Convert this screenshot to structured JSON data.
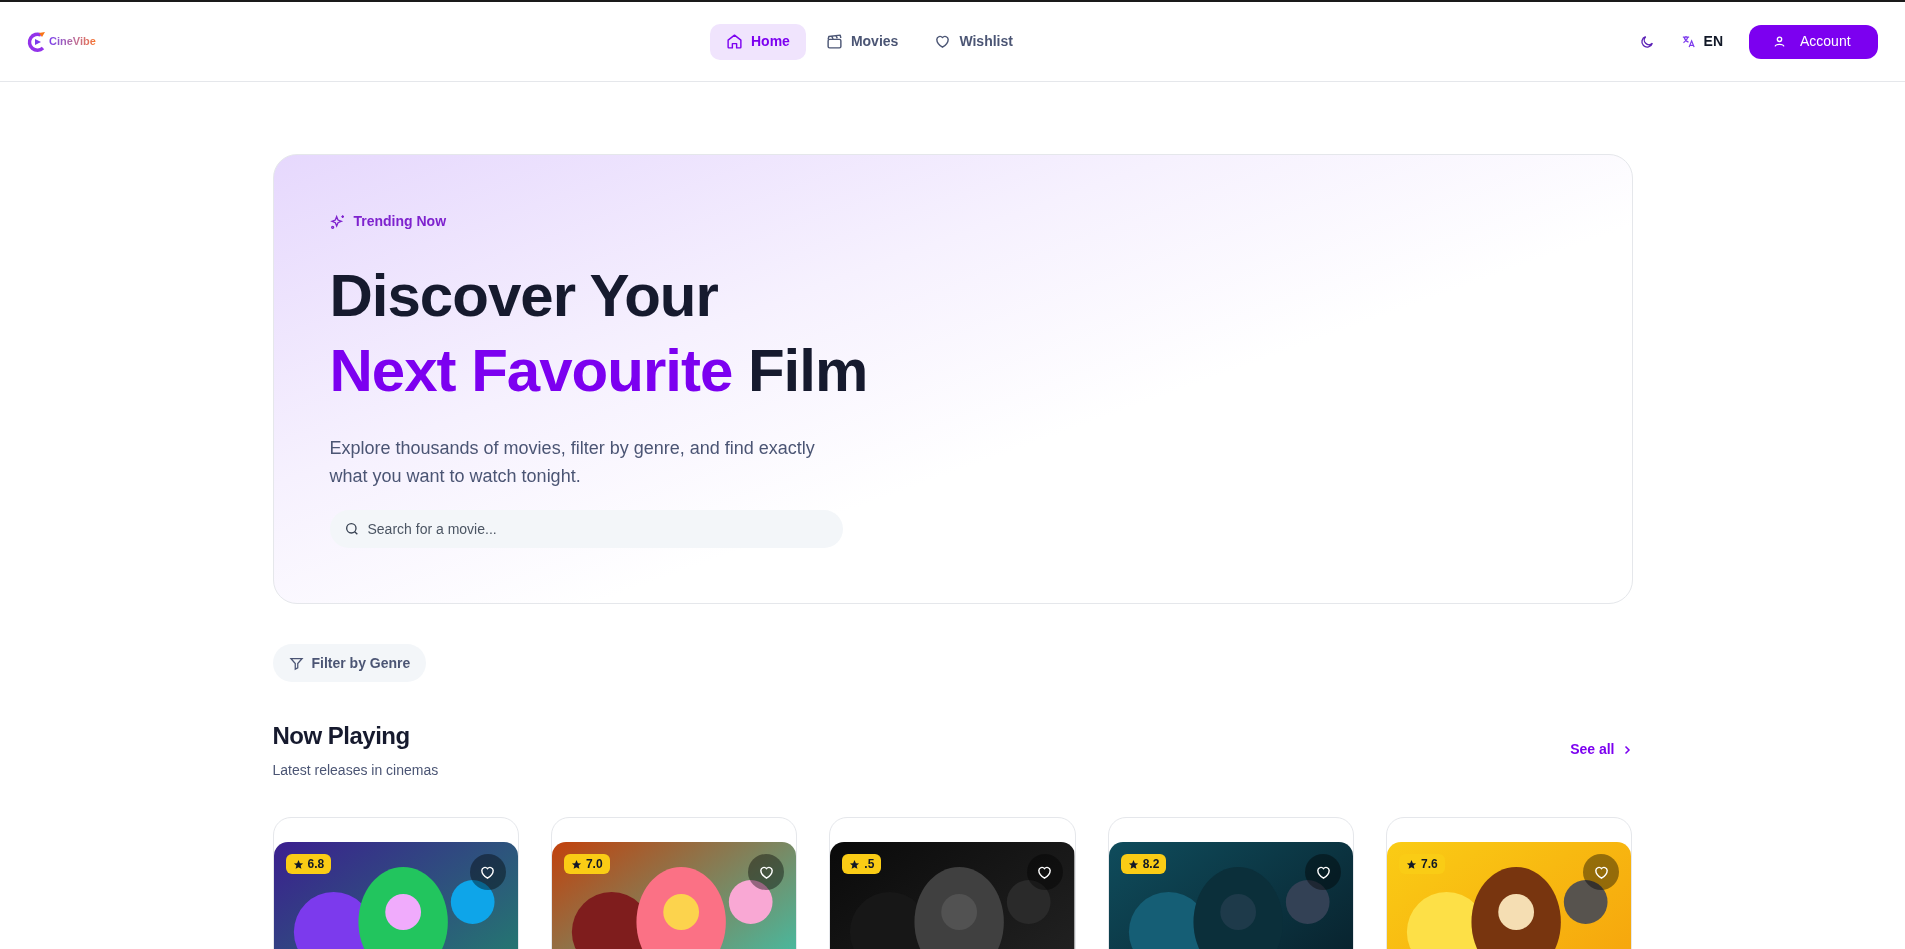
{
  "header": {
    "logo": "CineVibe",
    "nav": [
      {
        "label": "Home",
        "selected": true
      },
      {
        "label": "Movies",
        "selected": false
      },
      {
        "label": "Wishlist",
        "selected": false
      }
    ],
    "language": "EN",
    "account_button": "Account"
  },
  "hero": {
    "eyebrow": "Trending Now",
    "title_line1": "Discover Your",
    "title_highlight": "Next Favourite",
    "title_rest": "Film",
    "description": "Explore thousands of movies, filter by genre, and find exactly what you want to watch tonight.",
    "search": {
      "placeholder": "Search for a movie..."
    }
  },
  "filter_button": "Filter by Genre",
  "section": {
    "title": "Now Playing",
    "subtitle": "Latest releases in cinemas",
    "see_all": "See all",
    "movies": [
      {
        "rating": "6.8",
        "wishlisted": false
      },
      {
        "rating": "7.0",
        "wishlisted": false
      },
      {
        "rating": ".5",
        "wishlisted": false
      },
      {
        "rating": "8.2",
        "wishlisted": false
      },
      {
        "rating": "7.6",
        "wishlisted": false
      }
    ]
  }
}
